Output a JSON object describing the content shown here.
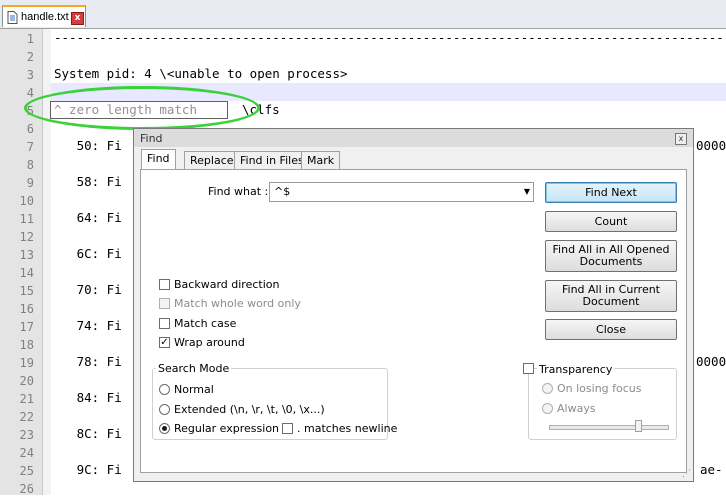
{
  "tab": {
    "filename": "handle.txt",
    "close_glyph": "x"
  },
  "editor": {
    "line_numbers": [
      "1",
      "2",
      "3",
      "4",
      "5",
      "6",
      "7",
      "8",
      "9",
      "10",
      "11",
      "12",
      "13",
      "14",
      "15",
      "16",
      "17",
      "18",
      "19",
      "20",
      "21",
      "22",
      "23",
      "24",
      "25",
      "26"
    ],
    "lines": {
      "l1": "------------------------------------------------------------------------------------------",
      "l3": "System pid: 4 \\<unable to open process>",
      "l5_rest": "\\clfs",
      "l7": "   50: Fi",
      "l7_tail": "0000",
      "l9": "   58: Fi",
      "l11": "   64: Fi",
      "l13": "   6C: Fi",
      "l15": "   70: Fi",
      "l17": "   74: Fi",
      "l19": "   78: Fi",
      "l19_tail": "0000",
      "l21": "   84: Fi",
      "l23": "   8C: Fi",
      "l25": "   9C: Fi",
      "l25_tail": "ae-"
    },
    "selected_text": "^ zero length match"
  },
  "dialog": {
    "title": "Find",
    "close_glyph": "x",
    "tabs": [
      "Find",
      "Replace",
      "Find in Files",
      "Mark"
    ],
    "find_what_label": "Find what :",
    "find_what_value": "^$",
    "buttons": {
      "find_next": "Find Next",
      "count": "Count",
      "find_all_opened_1": "Find All in All Opened",
      "find_all_opened_2": "Documents",
      "find_all_current_1": "Find All in Current",
      "find_all_current_2": "Document",
      "close": "Close"
    },
    "options": {
      "backward": "Backward direction",
      "whole_word": "Match whole word only",
      "match_case": "Match case",
      "wrap_around": "Wrap around"
    },
    "search_mode": {
      "title": "Search Mode",
      "normal": "Normal",
      "extended": "Extended (\\n, \\r, \\t, \\0, \\x...)",
      "regex": "Regular expression",
      "matches_newline": ". matches newline"
    },
    "transparency": {
      "title": "Transparency",
      "on_losing_focus": "On losing focus",
      "always": "Always"
    }
  }
}
